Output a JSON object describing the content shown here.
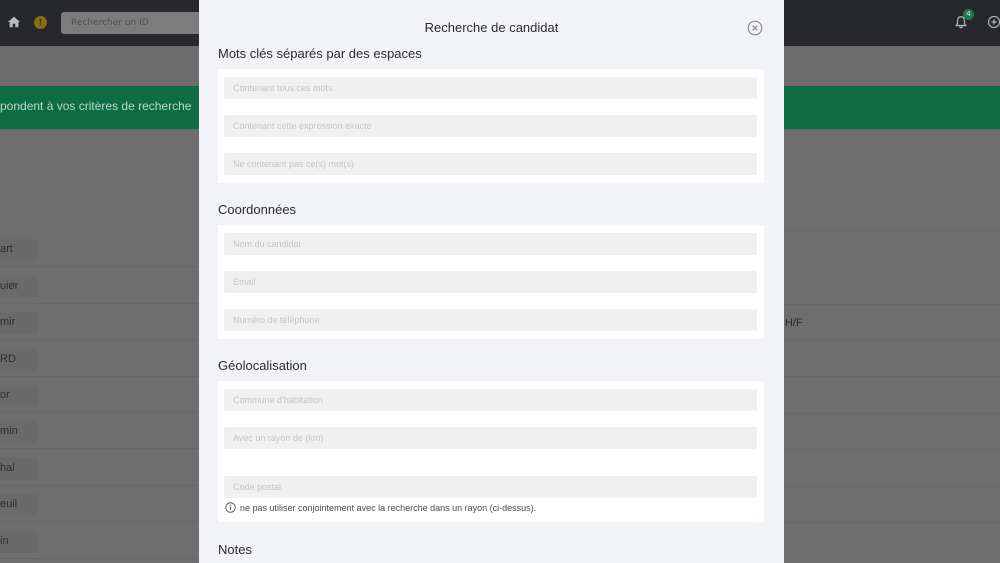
{
  "background": {
    "search_placeholder": "Rechercher un ID",
    "warning_badge": "!",
    "notification_count": "4",
    "banner_text": "pondent à vos critères de recherche",
    "rows": [
      "art",
      "uier",
      "mir",
      "RD",
      "or",
      "min",
      "hal",
      "euil",
      "in"
    ],
    "hf_label": "H/F"
  },
  "modal": {
    "title": "Recherche de candidat",
    "keywords": {
      "title": "Mots clés séparés par des espaces",
      "all_words_placeholder": "Contenant tous ces mots",
      "exact_phrase_placeholder": "Contenant cette expression exacte",
      "exclude_placeholder": "Ne contenant pas ce(s) mot(s)"
    },
    "contact": {
      "title": "Coordonnées",
      "name_placeholder": "Nom du candidat",
      "email_placeholder": "Email",
      "phone_placeholder": "Numéro de téléphone"
    },
    "geo": {
      "title": "Géolocalisation",
      "city_placeholder": "Commune d'habitation",
      "radius_placeholder": "Avec un rayon de (km)",
      "postal_placeholder": "Code postal",
      "hint": "ne pas utiliser conjointement avec la recherche dans un rayon (ci-dessus)."
    },
    "notes": {
      "title": "Notes"
    }
  },
  "colors": {
    "modal_bg": "#f2f3f7",
    "banner": "#0f6b46",
    "topbar": "#26282b"
  }
}
